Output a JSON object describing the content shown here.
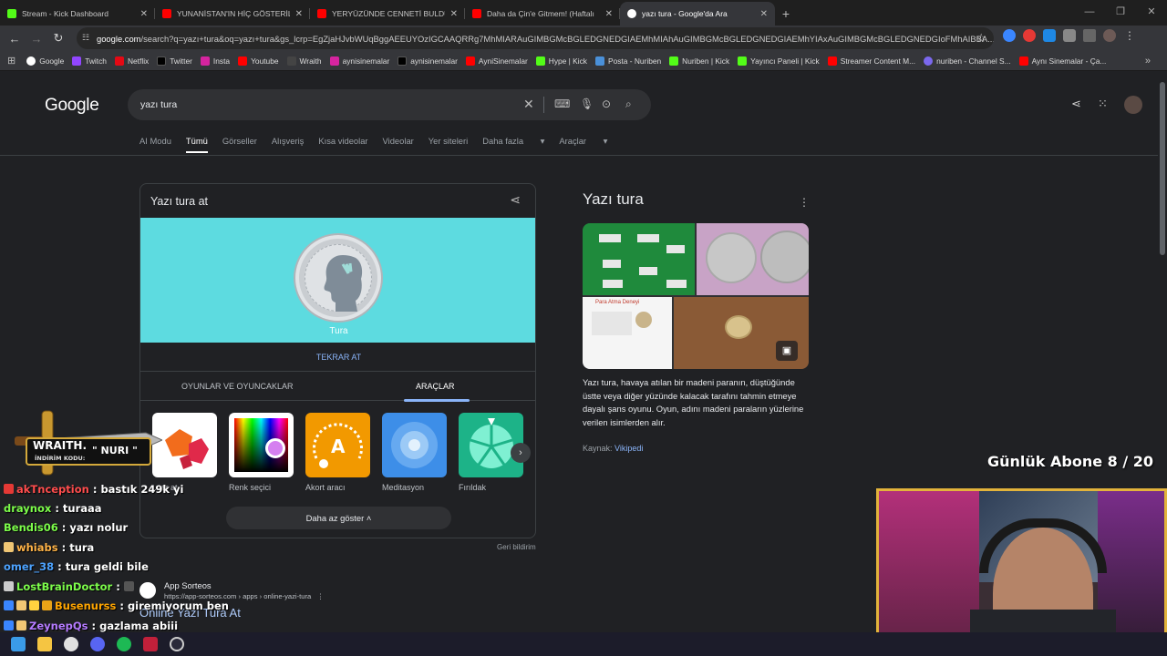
{
  "tabs": [
    {
      "title": "Stream - Kick Dashboard",
      "color": "#53fc18"
    },
    {
      "title": "YUNANİSTAN'IN HİÇ GÖSTERİL",
      "color": "#ff0000"
    },
    {
      "title": "YERYÜZÜNDE CENNETİ BULDU",
      "color": "#ff0000"
    },
    {
      "title": "Daha da Çin'e Gitmem! (Haftalı",
      "color": "#ff0000"
    },
    {
      "title": "yazı tura - Google'da Ara",
      "color": "#ffffff"
    }
  ],
  "url": {
    "domain": "google.com",
    "path": "/search?q=yazı+tura&oq=yazı+tura&gs_lcrp=EgZjaHJvbWUqBggAEEUYOzIGCAAQRRg7MhMIARAuGIMBGMcBGLEDGNEDGIAEMhMIAhAuGIMBGMcBGLEDGNEDGIAEMhYIAxAuGIMBGMcBGLEDGNEDGIoFMhAIBBA..."
  },
  "bookmarks": [
    "Google",
    "Twitch",
    "Netflix",
    "Twitter",
    "Insta",
    "Youtube",
    "Wraith",
    "aynisinemalar",
    "aynisinemalar",
    "AyniSinemalar",
    "Hype | Kick",
    "Posta - Nuriben",
    "Nuriben | Kick",
    "Yayıncı Paneli | Kick",
    "Streamer Content M...",
    "nuriben - Channel S...",
    "Aynı Sinemalar - Ça..."
  ],
  "search": {
    "logo": "Google",
    "query": "yazı tura"
  },
  "nav": [
    "AI Modu",
    "Tümü",
    "Görseller",
    "Alışveriş",
    "Kısa videolar",
    "Videolar",
    "Yer siteleri",
    "Daha fazla",
    "Araçlar"
  ],
  "card": {
    "title": "Yazı tura at",
    "coin_label": "Tura",
    "again": "TEKRAR AT",
    "tab_games": "OYUNLAR VE OYUNCAKLAR",
    "tab_tools": "ARAÇLAR",
    "tools": [
      "...ar at",
      "Renk seçici",
      "Akort aracı",
      "Meditasyon",
      "Fırıldak"
    ],
    "less": "Daha az göster",
    "report": "Geri bildirim"
  },
  "result": {
    "site": "App Sorteos",
    "url": "https://app-sorteos.com › apps › online-yazi-tura",
    "title": "Online Yazı Tura At"
  },
  "kp": {
    "title": "Yazı tura",
    "desc": "Yazı tura, havaya atılan bir madeni paranın, düştüğünde üstte veya diğer yüzünde kalacak tarafını tahmin etmeye dayalı şans oyunu. Oyun, adını madeni paraların yüzlerine verilen isimlerden alır.",
    "source_label": "Kaynak:",
    "source": "Vikipedi",
    "img3_caption": "Para Atma Deneyi"
  },
  "overlay": {
    "brand": "WRAITH.",
    "code_label": "İNDİRİM KODU:",
    "code": "\" NURI \"",
    "goal": "Günlük Abone 8 / 20"
  },
  "chat": [
    {
      "user": "akTnception",
      "msg": "bastık 249k yi",
      "color": "#ff4d4d"
    },
    {
      "user": "draynox",
      "msg": "turaaa",
      "color": "#7cfc4a"
    },
    {
      "user": "Bendis06",
      "msg": "yazı nolur",
      "color": "#7cfc4a"
    },
    {
      "user": "whiabs",
      "msg": "tura",
      "color": "#ffb347"
    },
    {
      "user": "omer_38",
      "msg": "tura geldi bile",
      "color": "#4da3ff"
    },
    {
      "user": "LostBrainDoctor",
      "msg": "",
      "color": "#7cfc4a"
    },
    {
      "user": "Busenurss",
      "msg": "giremiyorum ben",
      "color": "#ffa500"
    },
    {
      "user": "ZeynepQs",
      "msg": "gazlama abiii",
      "color": "#b57bff"
    }
  ]
}
